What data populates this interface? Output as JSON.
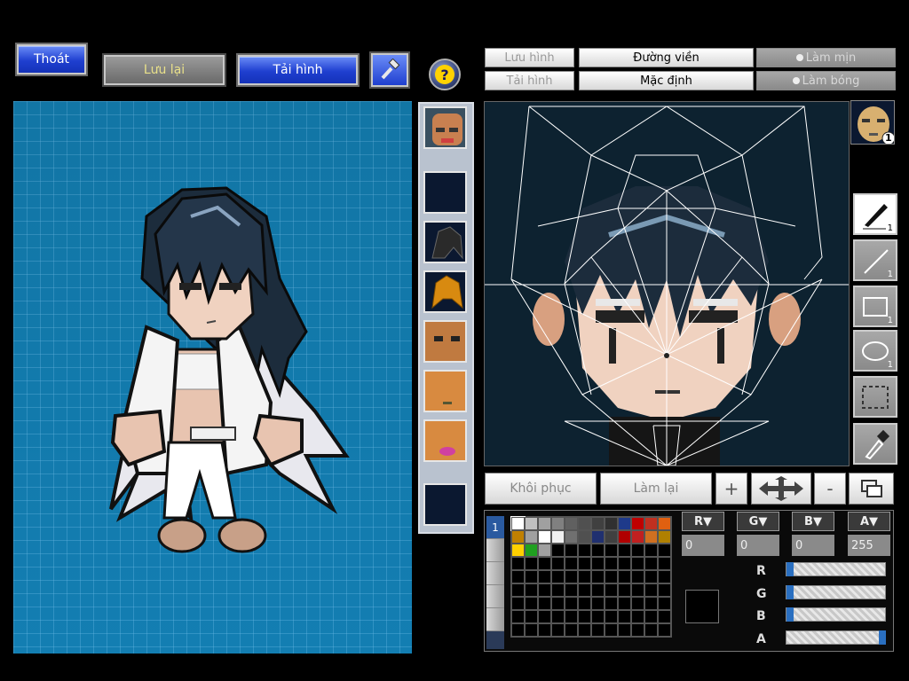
{
  "top_left": {
    "exit_label": "Thoát",
    "save_label": "Lưu lại",
    "load_label": "Tải hình"
  },
  "top_right": {
    "save_image_label": "Lưu hình",
    "load_image_label": "Tải hình",
    "outline_label": "Đường viền",
    "default_label": "Mặc định",
    "smooth_label": "Làm mịn",
    "gloss_label": "Làm bóng"
  },
  "lower": {
    "restore_label": "Khôi phục",
    "redo_label": "Làm lại",
    "plus_symbol": "+",
    "minus_symbol": "-"
  },
  "tools": {
    "pen_count": "1",
    "line_count": "1",
    "rect_count": "1",
    "ellipse_count": "1"
  },
  "color": {
    "r_label": "R",
    "g_label": "G",
    "b_label": "B",
    "a_label": "A",
    "r_value": "0",
    "g_value": "0",
    "b_value": "0",
    "a_value": "255"
  },
  "side_strip_label": "1",
  "avatar_badge": "1",
  "palette_colors": [
    "#ffffff",
    "#c0c0c0",
    "#a0a0a0",
    "#808080",
    "#606060",
    "#505050",
    "#404040",
    "#303030",
    "#1e3a8a",
    "#c00000",
    "#c03020",
    "#e06010",
    "#c08000",
    "#a0a0a0",
    "#ffffff",
    "#f0f0f0",
    "#707070",
    "#505050",
    "#203070",
    "#404040",
    "#b00000",
    "#c02020",
    "#d07020",
    "#b08000",
    "#ffd000",
    "#20a020",
    "#a0a0a0"
  ]
}
